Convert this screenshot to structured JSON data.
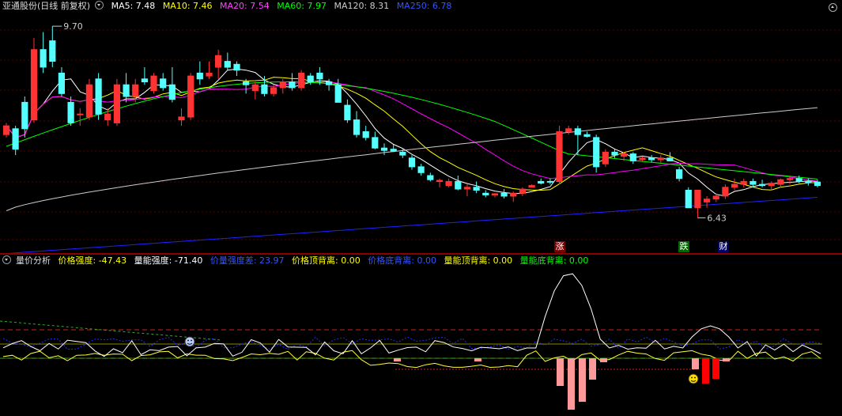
{
  "top_header": {
    "stock_title": "亚通股份(日线 前复权)",
    "ma5": "MA5: 7.48",
    "ma10": "MA10: 7.46",
    "ma20": "MA20: 7.54",
    "ma60": "MA60: 7.97",
    "ma120": "MA120: 8.31",
    "ma250": "MA250: 6.78"
  },
  "price_labels": {
    "high": "9.70",
    "low": "6.43"
  },
  "markers": {
    "rise": "涨",
    "fall": "跌",
    "finance": "财"
  },
  "bottom_header": {
    "indicator_name": "量价分析",
    "price_strength": "价格强度: -47.43",
    "volume_strength": "量能强度: -71.40",
    "volume_ratio": "价量强度差: 23.97",
    "price_top_div": "价格顶背离: 0.00",
    "price_bottom_div": "价格底背离: 0.00",
    "vol_top_div": "量能顶背离: 0.00",
    "vol_bottom_div": "量能底背离: 0.00"
  },
  "colors": {
    "up": "#ff3333",
    "down": "#54ffff",
    "ma5": "#ffffff",
    "ma10": "#ffff00",
    "ma20": "#ff00ff",
    "ma60": "#00ff00",
    "ma120": "#cccccc",
    "ma250": "#2020ff"
  },
  "candles": [
    [
      7.85,
      8.05,
      7.8,
      8.0
    ],
    [
      7.95,
      8.0,
      7.5,
      7.6
    ],
    [
      8.4,
      8.5,
      7.8,
      7.95
    ],
    [
      8.1,
      9.5,
      8.05,
      9.3
    ],
    [
      9.3,
      9.6,
      8.9,
      9.0
    ],
    [
      9.45,
      9.7,
      9.0,
      9.1
    ],
    [
      8.9,
      9.0,
      8.5,
      8.55
    ],
    [
      8.4,
      8.5,
      8.0,
      8.05
    ],
    [
      8.2,
      8.3,
      8.0,
      8.2
    ],
    [
      8.15,
      8.8,
      8.1,
      8.7
    ],
    [
      8.8,
      8.9,
      8.1,
      8.2
    ],
    [
      8.1,
      8.3,
      8.0,
      8.2
    ],
    [
      8.05,
      8.8,
      8.0,
      8.7
    ],
    [
      8.7,
      8.9,
      8.4,
      8.5
    ],
    [
      8.5,
      8.8,
      8.4,
      8.7
    ],
    [
      8.8,
      9.0,
      8.7,
      8.75
    ],
    [
      8.6,
      8.9,
      8.55,
      8.85
    ],
    [
      8.8,
      8.9,
      8.6,
      8.65
    ],
    [
      8.7,
      9.0,
      8.4,
      8.45
    ],
    [
      8.1,
      8.3,
      8.0,
      8.15
    ],
    [
      8.15,
      8.9,
      8.1,
      8.85
    ],
    [
      8.9,
      9.1,
      8.7,
      8.8
    ],
    [
      8.85,
      9.1,
      8.8,
      8.9
    ],
    [
      9.0,
      9.3,
      8.8,
      9.2
    ],
    [
      9.1,
      9.25,
      8.95,
      9.0
    ],
    [
      9.05,
      9.1,
      8.85,
      8.95
    ],
    [
      8.75,
      8.8,
      8.55,
      8.7
    ],
    [
      8.6,
      8.75,
      8.45,
      8.7
    ],
    [
      8.7,
      8.85,
      8.5,
      8.55
    ],
    [
      8.55,
      8.7,
      8.5,
      8.65
    ],
    [
      8.65,
      8.8,
      8.55,
      8.75
    ],
    [
      8.75,
      8.9,
      8.6,
      8.65
    ],
    [
      8.65,
      8.95,
      8.6,
      8.9
    ],
    [
      8.85,
      8.9,
      8.7,
      8.75
    ],
    [
      8.9,
      9.0,
      8.7,
      8.8
    ],
    [
      8.75,
      8.8,
      8.6,
      8.7
    ],
    [
      8.7,
      8.8,
      8.55,
      8.4
    ],
    [
      8.35,
      8.45,
      8.05,
      8.1
    ],
    [
      8.1,
      8.25,
      7.8,
      7.85
    ],
    [
      7.9,
      8.0,
      7.75,
      7.8
    ],
    [
      7.8,
      7.9,
      7.6,
      7.62
    ],
    [
      7.62,
      7.7,
      7.5,
      7.58
    ],
    [
      7.6,
      7.68,
      7.55,
      7.57
    ],
    [
      7.55,
      7.6,
      7.45,
      7.5
    ],
    [
      7.45,
      7.5,
      7.25,
      7.3
    ],
    [
      7.3,
      7.35,
      7.15,
      7.2
    ],
    [
      7.15,
      7.2,
      7.05,
      7.08
    ],
    [
      7.05,
      7.1,
      6.95,
      7.07
    ],
    [
      6.98,
      7.1,
      6.95,
      7.05
    ],
    [
      7.05,
      7.15,
      6.9,
      6.92
    ],
    [
      6.92,
      7.0,
      6.8,
      6.95
    ],
    [
      6.95,
      7.05,
      6.85,
      6.9
    ],
    [
      6.85,
      6.9,
      6.78,
      6.82
    ],
    [
      6.82,
      6.85,
      6.78,
      6.84
    ],
    [
      6.85,
      6.92,
      6.76,
      6.8
    ],
    [
      6.8,
      6.88,
      6.7,
      6.85
    ],
    [
      6.85,
      6.95,
      6.8,
      6.92
    ],
    [
      6.95,
      7.0,
      6.95,
      6.98
    ],
    [
      7.05,
      7.1,
      7.0,
      7.02
    ],
    [
      7.05,
      7.1,
      7.0,
      7.04
    ],
    [
      7.05,
      8.0,
      7.0,
      7.9
    ],
    [
      7.9,
      8.0,
      7.85,
      7.95
    ],
    [
      7.95,
      8.0,
      7.5,
      7.85
    ],
    [
      7.85,
      7.9,
      7.8,
      7.82
    ],
    [
      7.8,
      7.85,
      7.2,
      7.3
    ],
    [
      7.35,
      7.6,
      7.3,
      7.55
    ],
    [
      7.55,
      7.6,
      7.45,
      7.5
    ],
    [
      7.48,
      7.55,
      7.4,
      7.52
    ],
    [
      7.52,
      7.55,
      7.35,
      7.4
    ],
    [
      7.42,
      7.48,
      7.4,
      7.45
    ],
    [
      7.45,
      7.5,
      7.38,
      7.42
    ],
    [
      7.42,
      7.5,
      7.35,
      7.45
    ],
    [
      7.45,
      7.55,
      7.4,
      7.4
    ],
    [
      7.25,
      7.3,
      7.05,
      7.1
    ],
    [
      6.9,
      6.95,
      6.6,
      6.6
    ],
    [
      6.6,
      6.65,
      6.43,
      6.9
    ],
    [
      6.7,
      6.8,
      6.6,
      6.75
    ],
    [
      6.75,
      6.85,
      6.7,
      6.8
    ],
    [
      6.8,
      7.0,
      6.75,
      6.95
    ],
    [
      6.95,
      7.1,
      6.9,
      7.0
    ],
    [
      7.0,
      7.1,
      6.95,
      7.05
    ],
    [
      7.05,
      7.1,
      6.95,
      7.0
    ],
    [
      7.0,
      7.08,
      6.95,
      6.98
    ],
    [
      6.98,
      7.05,
      6.9,
      7.02
    ],
    [
      7.0,
      7.1,
      6.95,
      7.08
    ],
    [
      7.08,
      7.15,
      7.0,
      7.1
    ],
    [
      7.1,
      7.15,
      7.02,
      7.05
    ],
    [
      7.05,
      7.1,
      6.98,
      7.04
    ],
    [
      7.04,
      7.08,
      6.95,
      6.98
    ]
  ]
}
